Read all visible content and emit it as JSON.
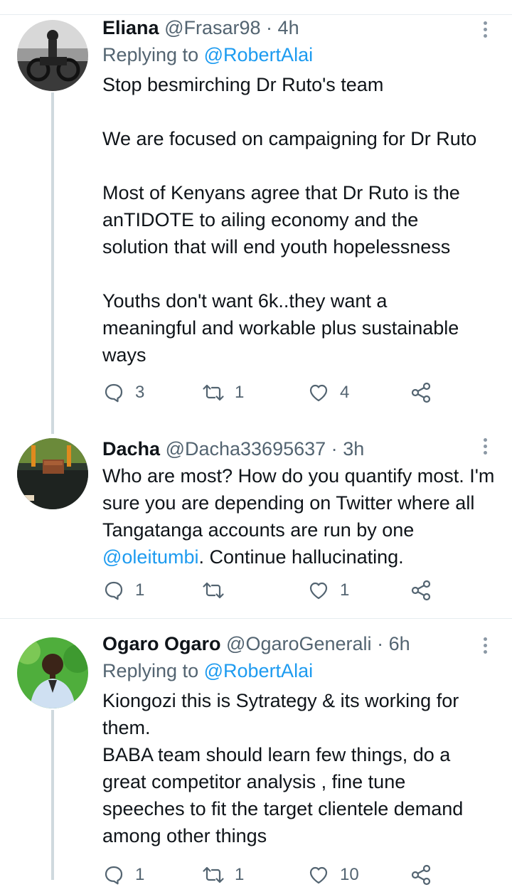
{
  "tweets": [
    {
      "name": "Eliana",
      "handle": "@Frasar98",
      "time": "4h",
      "replying_prefix": "Replying to",
      "replying_to": "@RobertAlai",
      "paragraphs": [
        "Stop besmirching Dr Ruto's team",
        "We are focused on campaigning for Dr Ruto",
        "Most of Kenyans agree that Dr Ruto is the anTIDOTE to ailing economy and the solution that will end youth hopelessness",
        "Youths don't want 6k..they want a meaningful and workable plus sustainable ways"
      ],
      "replies": "3",
      "retweets": "1",
      "likes": "4"
    },
    {
      "name": "Dacha",
      "handle": "@Dacha33695637",
      "time": "3h",
      "text_before_mention": "Who are most? How do you quantify most. I'm sure you are depending on Twitter where all Tangatanga accounts are run by one",
      "mention": "@oleitumbi",
      "text_after_mention": ". Continue hallucinating.",
      "replies": "1",
      "retweets": "",
      "likes": "1"
    },
    {
      "name": "Ogaro Ogaro",
      "handle": "@OgaroGenerali",
      "time": "6h",
      "replying_prefix": "Replying to",
      "replying_to": "@RobertAlai",
      "lines": [
        "Kiongozi this is Sytrategy & its working for them.",
        "BABA team should learn few things, do a great competitor analysis , fine tune speeches to fit the target clientele demand among other things"
      ],
      "replies": "1",
      "retweets": "1",
      "likes": "10"
    }
  ],
  "separator": "·",
  "colors": {
    "link": "#1d9bf0",
    "muted": "#536471",
    "text": "#0f1419",
    "line": "#cfd9de"
  }
}
